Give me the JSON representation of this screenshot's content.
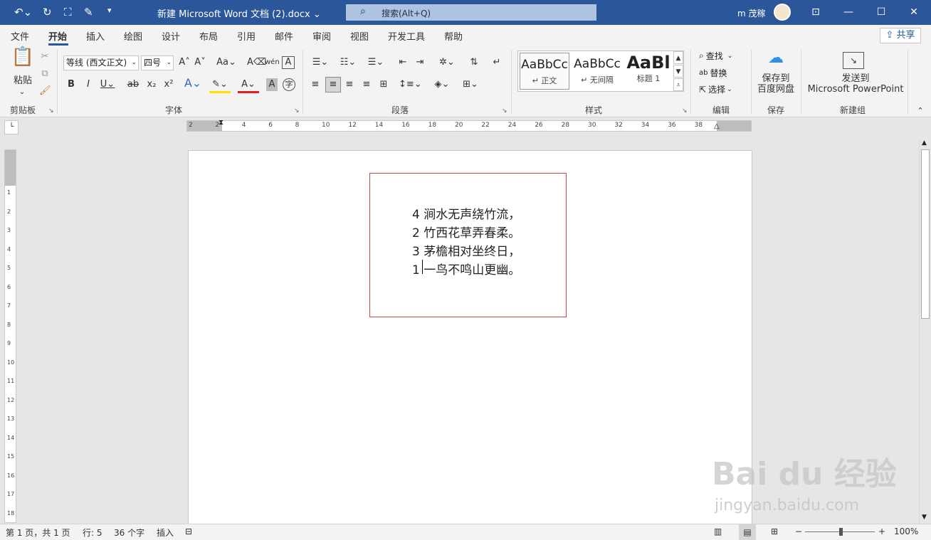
{
  "titlebar": {
    "title": "新建 Microsoft Word 文档 (2).docx ⌄",
    "search": "搜索(Alt+Q)",
    "user": "m 茂稼"
  },
  "tabs": [
    {
      "label": "文件"
    },
    {
      "label": "开始"
    },
    {
      "label": "插入"
    },
    {
      "label": "绘图"
    },
    {
      "label": "设计"
    },
    {
      "label": "布局"
    },
    {
      "label": "引用"
    },
    {
      "label": "邮件"
    },
    {
      "label": "审阅"
    },
    {
      "label": "视图"
    },
    {
      "label": "开发工具"
    },
    {
      "label": "帮助"
    }
  ],
  "share": "共享",
  "ribbon": {
    "clipboard": {
      "paste": "粘贴",
      "label": "剪贴板"
    },
    "font": {
      "font_name": "等线 (西文正文)",
      "font_size": "四号",
      "label": "字体"
    },
    "paragraph": {
      "label": "段落"
    },
    "styles": {
      "label": "样式",
      "items": [
        {
          "sample": "AaBbCc",
          "name": "↵ 正文"
        },
        {
          "sample": "AaBbCc",
          "name": "↵ 无间隔"
        },
        {
          "sample": "AaBl",
          "name": "标题 1"
        }
      ]
    },
    "editing": {
      "find": "查找",
      "replace": "替换",
      "select": "选择",
      "label": "编辑"
    },
    "save": {
      "button": "保存到\n百度网盘",
      "label": "保存"
    },
    "newgroup": {
      "button": "发送到\nMicrosoft PowerPoint",
      "label": "新建组"
    }
  },
  "document": {
    "lines": [
      "4 涧水无声绕竹流，",
      "2 竹西花草弄春柔。",
      "3 茅檐相对坐终日，",
      "1 一鸟不鸣山更幽。"
    ]
  },
  "status": {
    "page": "第 1 页，共 1 页",
    "line": "行: 5",
    "words": "36 个字",
    "insert": "插入",
    "zoom": "100%"
  },
  "watermark": {
    "brand": "Bai du 经验",
    "url": "jingyan.baidu.com"
  }
}
